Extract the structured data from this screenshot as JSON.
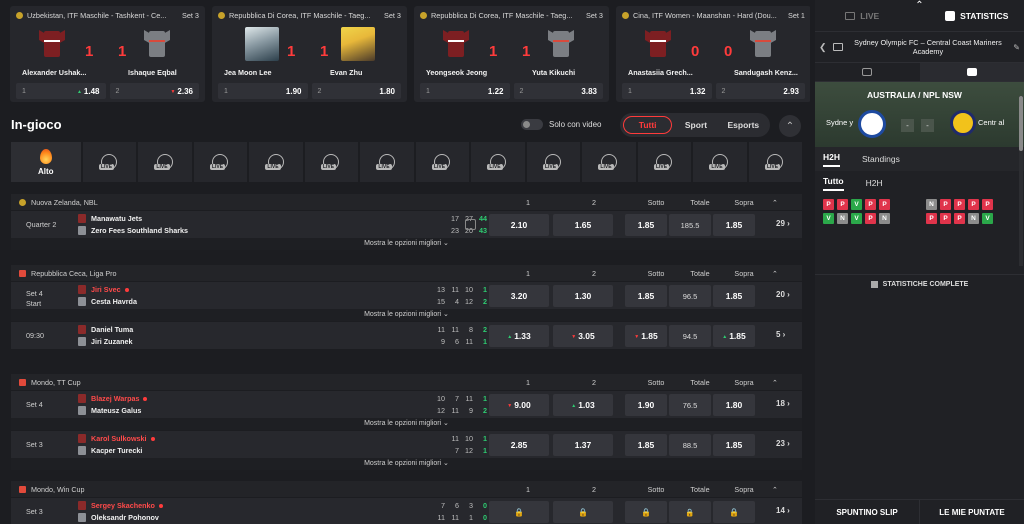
{
  "cards": [
    {
      "league": "Uzbekistan, ITF Maschile - Tashkent - Ce...",
      "set": "Set 3",
      "p1": "Alexander Ushak...",
      "p2": "Ishaque Eqbal",
      "s1": "1",
      "s2": "1",
      "o1": "1.48",
      "o2": "2.36",
      "t1": "up",
      "t2": "down"
    },
    {
      "league": "Repubblica Di Corea, ITF Maschile - Taeg...",
      "set": "Set 3",
      "p1": "Jea Moon Lee",
      "p2": "Evan Zhu",
      "s1": "1",
      "s2": "1",
      "o1": "1.90",
      "o2": "1.80",
      "t1": "",
      "t2": ""
    },
    {
      "league": "Repubblica Di Corea, ITF Maschile - Taeg...",
      "set": "Set 3",
      "p1": "Yeongseok Jeong",
      "p2": "Yuta Kikuchi",
      "s1": "1",
      "s2": "1",
      "o1": "1.22",
      "o2": "3.83",
      "t1": "",
      "t2": ""
    },
    {
      "league": "Cina, ITF Women - Maanshan - Hard (Dou...",
      "set": "Set 1",
      "p1": "Anastasiia Grech...",
      "p2": "Sandugash Kenz...",
      "s1": "0",
      "s2": "0",
      "o1": "1.32",
      "o2": "2.93",
      "t1": "",
      "t2": ""
    }
  ],
  "odds_labels": {
    "one": "1",
    "two": "2"
  },
  "ingioco": "In-gioco",
  "toggle_label": "Solo con video",
  "segments": [
    "Tutti",
    "Sport",
    "Esports"
  ],
  "sports": {
    "first": "Alto",
    "live": "LIVE",
    "items": [
      "basketball-icon",
      "basketball-icon",
      "tennis-icon",
      "ice-hockey-icon",
      "soccer-icon",
      "table-tennis-icon",
      "volleyball-icon",
      "american-football-icon",
      "handball-icon",
      "esports-icon",
      "volleyball-icon",
      "futsal-icon",
      "badminton-icon"
    ]
  },
  "col_headers": {
    "one": "1",
    "two": "2",
    "under": "Sotto",
    "total": "Totale",
    "over": "Sopra"
  },
  "mostra": "Mostra le opzioni migliori",
  "blocks": [
    {
      "league": "Nuova Zelanda, NBL",
      "rows": [
        {
          "state": "Quarter 2",
          "state2": "",
          "p1": "Manawatu Jets",
          "p2": "Zero Fees Southland Sharks",
          "red1": false,
          "red2": false,
          "s1": [
            "17",
            "27",
            "44"
          ],
          "s2": [
            "23",
            "20",
            "43"
          ],
          "o1": "2.10",
          "o2": "1.65",
          "u": "1.85",
          "t": "185.5",
          "ov": "1.85",
          "more": "29",
          "mostra": true
        }
      ]
    },
    {
      "league": "Repubblica Ceca, Liga Pro",
      "rows": [
        {
          "state": "Set 4",
          "state2": "Start",
          "p1": "Jiri Svec",
          "p2": "Cesta Havrda",
          "red1": true,
          "red2": false,
          "s1": [
            "13",
            "11",
            "10",
            "1"
          ],
          "s2": [
            "15",
            "4",
            "12",
            "2"
          ],
          "o1": "3.20",
          "o2": "1.30",
          "u": "1.85",
          "t": "96.5",
          "ov": "1.85",
          "more": "20",
          "mostra": true
        },
        {
          "state": "09:30",
          "state2": "",
          "p1": "Daniel Tuma",
          "p2": "Jiri Zuzanek",
          "red1": false,
          "red2": false,
          "s1": [
            "11",
            "11",
            "8",
            "2"
          ],
          "s2": [
            "9",
            "6",
            "11",
            "1"
          ],
          "o1": "1.33",
          "o2": "3.05",
          "u": "1.85",
          "t": "94.5",
          "ov": "1.85",
          "more": "5",
          "mostra": false
        }
      ]
    },
    {
      "league": "Mondo, TT Cup",
      "rows": [
        {
          "state": "Set 4",
          "state2": "",
          "p1": "Blazej Warpas",
          "p2": "Mateusz Galus",
          "red1": true,
          "red2": false,
          "s1": [
            "10",
            "7",
            "11",
            "1"
          ],
          "s2": [
            "12",
            "11",
            "9",
            "2"
          ],
          "o1": "9.00",
          "o2": "1.03",
          "u": "1.90",
          "t": "76.5",
          "ov": "1.80",
          "more": "18",
          "mostra": true
        },
        {
          "state": "Set 3",
          "state2": "",
          "p1": "Karol Sulkowski",
          "p2": "Kacper Turecki",
          "red1": true,
          "red2": false,
          "s1": [
            "11",
            "10",
            "1"
          ],
          "s2": [
            "7",
            "12",
            "1"
          ],
          "o1": "2.85",
          "o2": "1.37",
          "u": "1.85",
          "t": "88.5",
          "ov": "1.85",
          "more": "23",
          "mostra": true
        }
      ]
    },
    {
      "league": "Mondo, Win Cup",
      "rows": [
        {
          "state": "Set 3",
          "state2": "",
          "p1": "Sergey Skachenko",
          "p2": "Oleksandr Pohonov",
          "red1": true,
          "red2": false,
          "s1": [
            "7",
            "6",
            "3",
            "0"
          ],
          "s2": [
            "11",
            "11",
            "1",
            "0"
          ],
          "o1": "",
          "o2": "",
          "u": "",
          "t": "",
          "ov": "",
          "more": "14",
          "mostra": false
        }
      ]
    }
  ],
  "right": {
    "tab_live": "LIVE",
    "tab_stats": "STATISTICS",
    "match_title": "Sydney Olympic FC – Central Coast Mariners Academy",
    "league": "AUSTRALIA / NPL NSW",
    "team1": "Sydne y",
    "team2": "Centr al",
    "score1": "-",
    "score2": "-",
    "h2h_tabs": [
      "H2H",
      "Standings"
    ],
    "h2h_sub": [
      "Tutto",
      "H2H"
    ],
    "form_left": [
      "P",
      "P",
      "V",
      "P",
      "P",
      "V",
      "N",
      "V",
      "P",
      "N"
    ],
    "form_right": [
      "N",
      "P",
      "P",
      "P",
      "P",
      "P",
      "P",
      "P",
      "N",
      "V"
    ],
    "full_stats": "STATISTICHE COMPLETE",
    "bottom": [
      "SPUNTINO SLIP",
      "LE MIE PUNTATE"
    ]
  }
}
